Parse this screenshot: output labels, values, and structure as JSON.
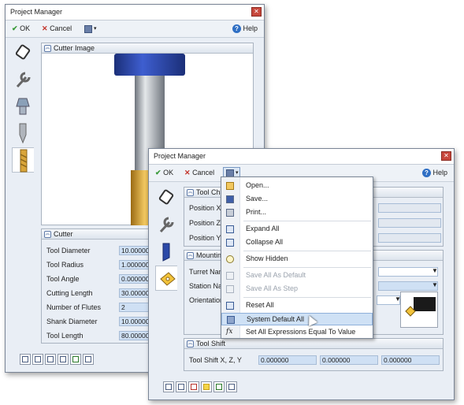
{
  "back_window": {
    "title": "Project Manager",
    "toolbar": {
      "ok": "OK",
      "cancel": "Cancel",
      "help": "Help"
    },
    "cutter_image_panel": {
      "title": "Cutter Image"
    },
    "cutter_panel": {
      "title": "Cutter",
      "fields": [
        {
          "label": "Tool Diameter",
          "value": "10.000000"
        },
        {
          "label": "Tool Radius",
          "value": "1.000000"
        },
        {
          "label": "Tool Angle",
          "value": "0.000000"
        },
        {
          "label": "Cutting Length",
          "value": "30.000000"
        },
        {
          "label": "Number of Flutes",
          "value": "2"
        },
        {
          "label": "Shank Diameter",
          "value": "10.000000"
        },
        {
          "label": "Tool Length",
          "value": "80.000000"
        }
      ]
    }
  },
  "front_window": {
    "title": "Project Manager",
    "toolbar": {
      "ok": "OK",
      "cancel": "Cancel",
      "help": "Help"
    },
    "tool_change_panel": {
      "title": "Tool Cha",
      "fields": [
        {
          "label": "Position X"
        },
        {
          "label": "Position Z"
        },
        {
          "label": "Position Y"
        }
      ]
    },
    "mounting_panel": {
      "title": "Mounting",
      "fields": [
        {
          "label": "Turret Nam"
        },
        {
          "label": "Station Nam"
        },
        {
          "label": "Orientation"
        }
      ]
    },
    "tool_shift_panel": {
      "title": "Tool Shift",
      "label": "Tool Shift X, Z, Y",
      "values": [
        "0.000000",
        "0.000000",
        "0.000000"
      ]
    }
  },
  "menu": {
    "items": [
      {
        "label": "Open...",
        "icon": "folder-open-icon",
        "disabled": false
      },
      {
        "label": "Save...",
        "icon": "save-icon",
        "disabled": false
      },
      {
        "label": "Print...",
        "icon": "printer-icon",
        "disabled": false
      },
      {
        "label": "Expand All",
        "icon": "expand-icon",
        "disabled": false
      },
      {
        "label": "Collapse All",
        "icon": "collapse-icon",
        "disabled": false
      },
      {
        "label": "Show Hidden",
        "icon": "lightbulb-icon",
        "disabled": false
      },
      {
        "label": "Save All As Default",
        "icon": "save-default-icon",
        "disabled": true
      },
      {
        "label": "Save All As Step",
        "icon": "save-step-icon",
        "disabled": true
      },
      {
        "label": "Reset All",
        "icon": "reset-icon",
        "disabled": false
      },
      {
        "label": "System Default All",
        "icon": "system-default-icon",
        "disabled": false,
        "highlighted": true
      },
      {
        "label": "Set All Expressions Equal To Value",
        "icon": "fx-icon",
        "disabled": false
      }
    ]
  },
  "colors": {
    "tool_shank": "#9aa0a8",
    "tool_flutes": "#d9a53a",
    "tool_holder": "#2b49a8",
    "highlight": "#cfe1f5",
    "field_fill": "#cfe0f4"
  }
}
